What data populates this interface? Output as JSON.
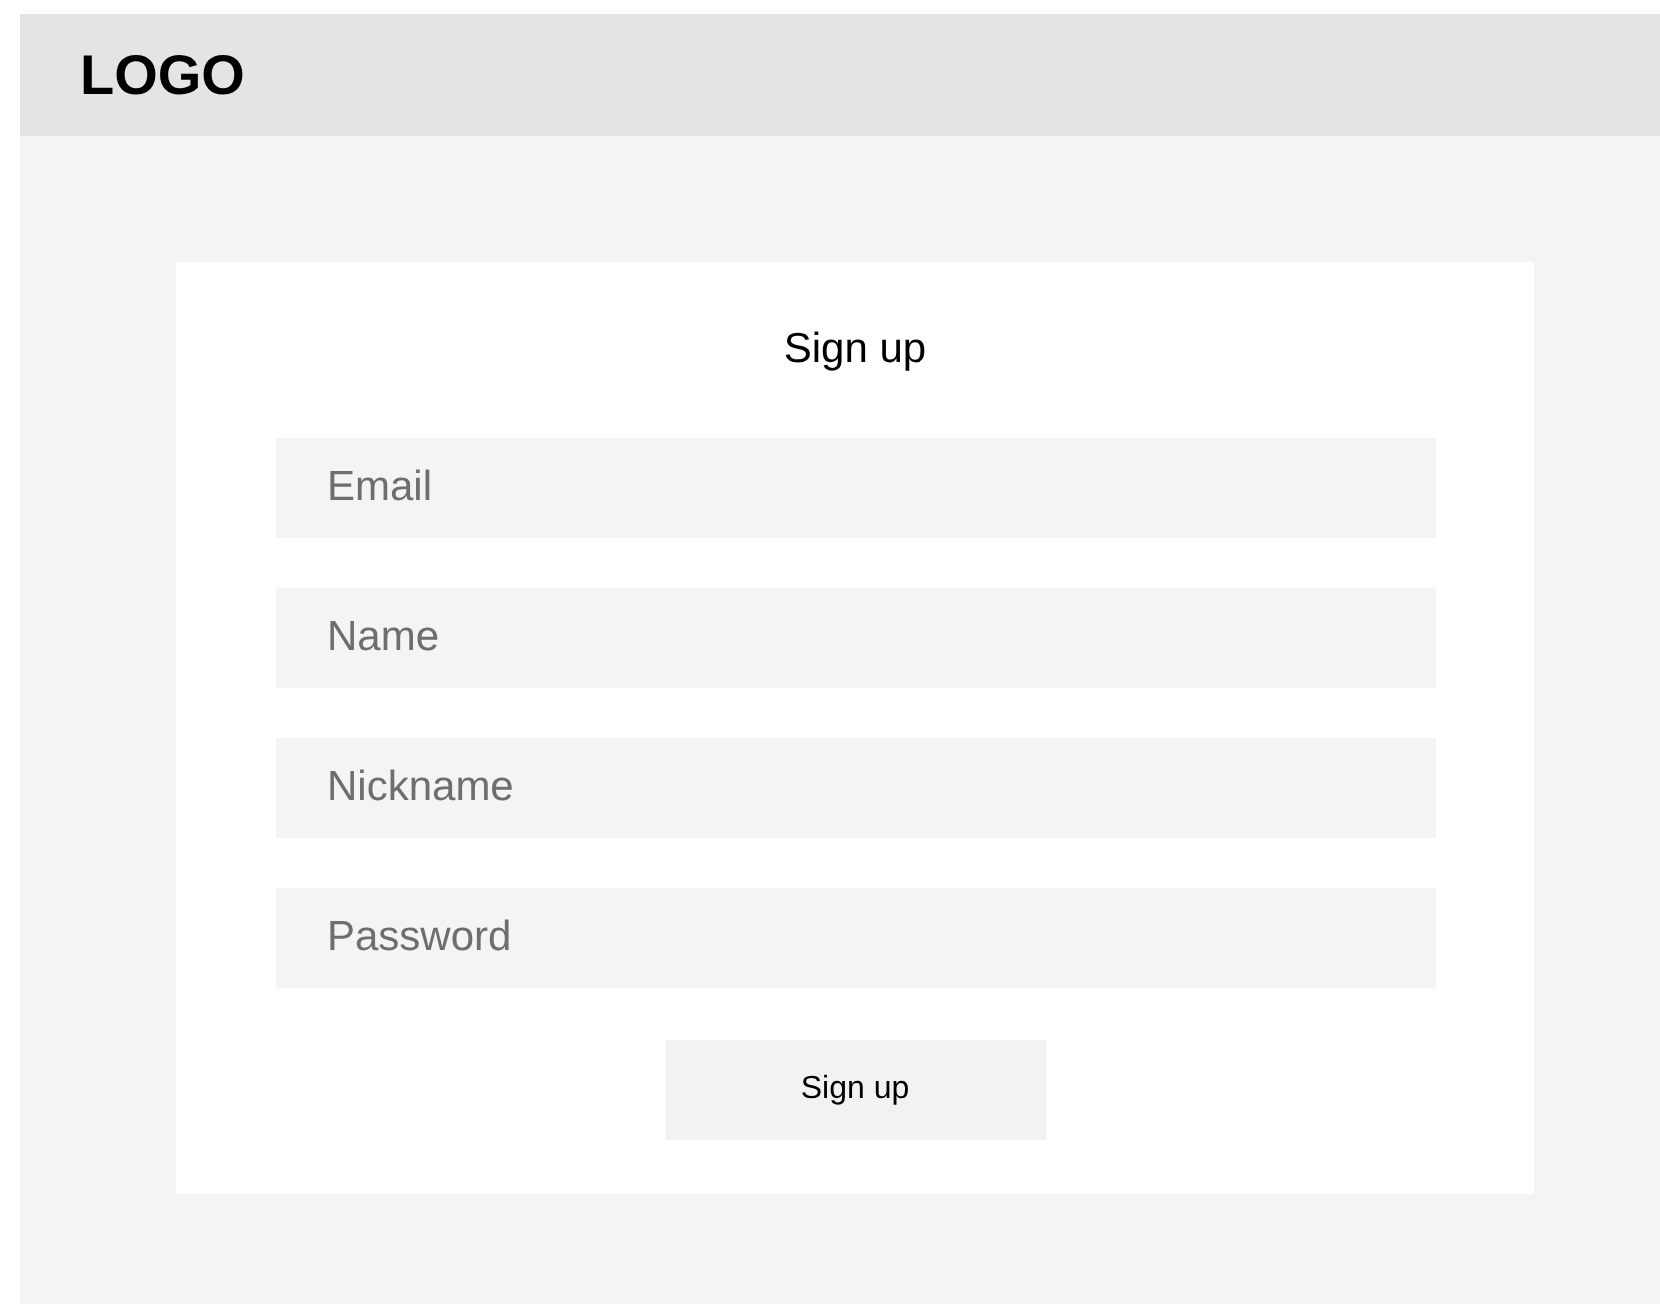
{
  "header": {
    "logo": "LOGO"
  },
  "form": {
    "title": "Sign up",
    "fields": [
      {
        "placeholder": "Email"
      },
      {
        "placeholder": "Name"
      },
      {
        "placeholder": "Nickname"
      },
      {
        "placeholder": "Password"
      }
    ],
    "button": "Sign up"
  }
}
